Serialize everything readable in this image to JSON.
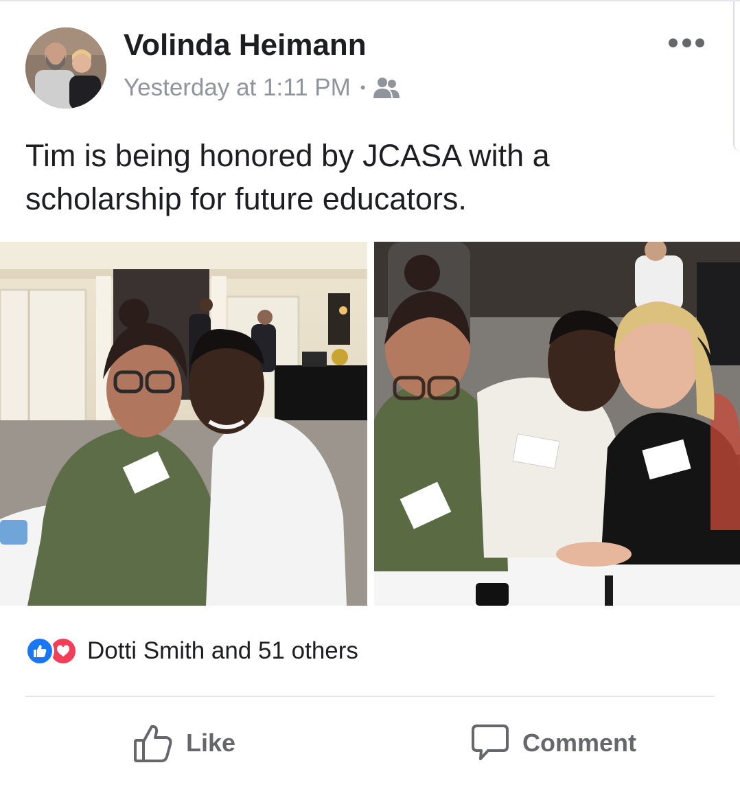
{
  "post": {
    "author": "Volinda Heimann",
    "timestamp": "Yesterday at 1:11 PM",
    "separator": "•",
    "audience_icon": "friends-icon",
    "more_icon": "more-options-icon",
    "text": "Tim is being honored by JCASA with a scholarship for future educators.",
    "photos": [
      {
        "description_icon": "photo"
      },
      {
        "description_icon": "photo"
      }
    ]
  },
  "reactions": {
    "icons": [
      "like-reaction-icon",
      "love-reaction-icon"
    ],
    "summary": "Dotti Smith and 51 others"
  },
  "actions": {
    "like_label": "Like",
    "comment_label": "Comment"
  },
  "colors": {
    "like_blue": "#1877f2",
    "love_red": "#f33e58",
    "meta_gray": "#90949c",
    "action_gray": "#65676b"
  }
}
